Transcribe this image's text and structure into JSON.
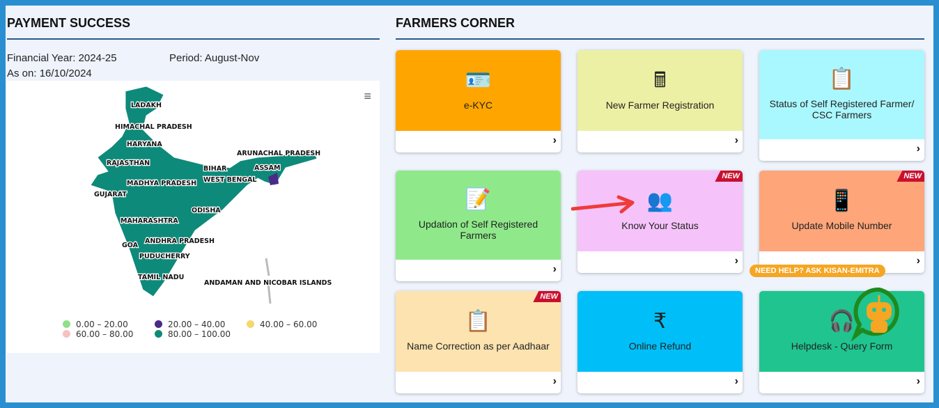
{
  "payment": {
    "title": "PAYMENT SUCCESS",
    "financial_year": "Financial Year: 2024-25",
    "period": "Period: August-Nov",
    "as_on": "As on: 16/10/2024",
    "map_labels": [
      "LADAKH",
      "HIMACHAL PRADESH",
      "HARYANA",
      "RAJASTHAN",
      "ARUNACHAL PRADESH",
      "BIHAR",
      "ASSAM",
      "MADHYA PRADESH",
      "WEST BENGAL",
      "GUJARAT",
      "ODISHA",
      "MAHARASHTRA",
      "GOA",
      "ANDHRA PRADESH",
      "PUDUCHERRY",
      "TAMIL NADU",
      "ANDAMAN AND NICOBAR ISLANDS"
    ],
    "legend": [
      {
        "label": "0.00 – 20.00",
        "color": "#90e08a"
      },
      {
        "label": "20.00 – 40.00",
        "color": "#4b2a8a"
      },
      {
        "label": "40.00 – 60.00",
        "color": "#f5d76e"
      },
      {
        "label": "60.00 – 80.00",
        "color": "#f7c1c1"
      },
      {
        "label": "80.00 – 100.00",
        "color": "#0e8a7a"
      }
    ]
  },
  "farmers": {
    "title": "FARMERS CORNER",
    "help_label": "NEED HELP? ASK KISAN-EMITRA",
    "new_badge": "NEW",
    "cards": [
      {
        "label": "e-KYC",
        "icon": "id-card-icon",
        "color": "#ffa500"
      },
      {
        "label": "New Farmer Registration",
        "icon": "cash-register-icon",
        "color": "#ecf0a4"
      },
      {
        "label": "Status of Self Registered Farmer/ CSC Farmers",
        "icon": "clipboard-icon",
        "color": "#aaf8ff"
      },
      {
        "label": "Updation of Self Registered Farmers",
        "icon": "file-plus-icon",
        "color": "#8fe98a"
      },
      {
        "label": "Know Your Status",
        "icon": "users-icon",
        "color": "#f5c3f9"
      },
      {
        "label": "Update Mobile Number",
        "icon": "mobile-icon",
        "color": "#fea57a"
      },
      {
        "label": "Name Correction as per Aadhaar",
        "icon": "paste-icon",
        "color": "#fde3b0"
      },
      {
        "label": "Online Refund",
        "icon": "rupee-refund-icon",
        "color": "#00bff8"
      },
      {
        "label": "Helpdesk - Query Form",
        "icon": "headset-icon",
        "color": "#20c48f"
      }
    ]
  }
}
